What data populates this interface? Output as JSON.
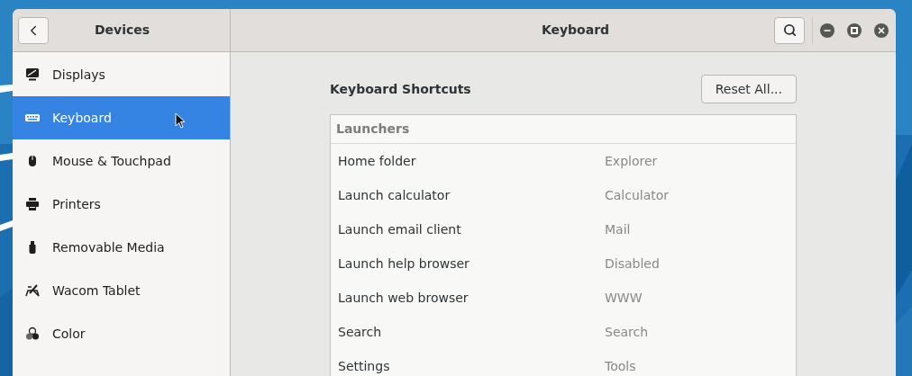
{
  "sidebar": {
    "title": "Devices",
    "items": [
      {
        "label": "Displays",
        "kind": "display",
        "selected": false
      },
      {
        "label": "Keyboard",
        "kind": "keyboard",
        "selected": true
      },
      {
        "label": "Mouse & Touchpad",
        "kind": "mouse",
        "selected": false
      },
      {
        "label": "Printers",
        "kind": "printer",
        "selected": false
      },
      {
        "label": "Removable Media",
        "kind": "usb",
        "selected": false
      },
      {
        "label": "Wacom Tablet",
        "kind": "tablet",
        "selected": false
      },
      {
        "label": "Color",
        "kind": "color",
        "selected": false
      }
    ]
  },
  "header": {
    "title": "Keyboard"
  },
  "shortcuts": {
    "title": "Keyboard Shortcuts",
    "reset_button": "Reset All...",
    "section": "Launchers",
    "rows": [
      {
        "name": "Home folder",
        "shortcut": "Explorer"
      },
      {
        "name": "Launch calculator",
        "shortcut": "Calculator"
      },
      {
        "name": "Launch email client",
        "shortcut": "Mail"
      },
      {
        "name": "Launch help browser",
        "shortcut": "Disabled"
      },
      {
        "name": "Launch web browser",
        "shortcut": "WWW"
      },
      {
        "name": "Search",
        "shortcut": "Search"
      },
      {
        "name": "Settings",
        "shortcut": "Tools"
      }
    ]
  }
}
